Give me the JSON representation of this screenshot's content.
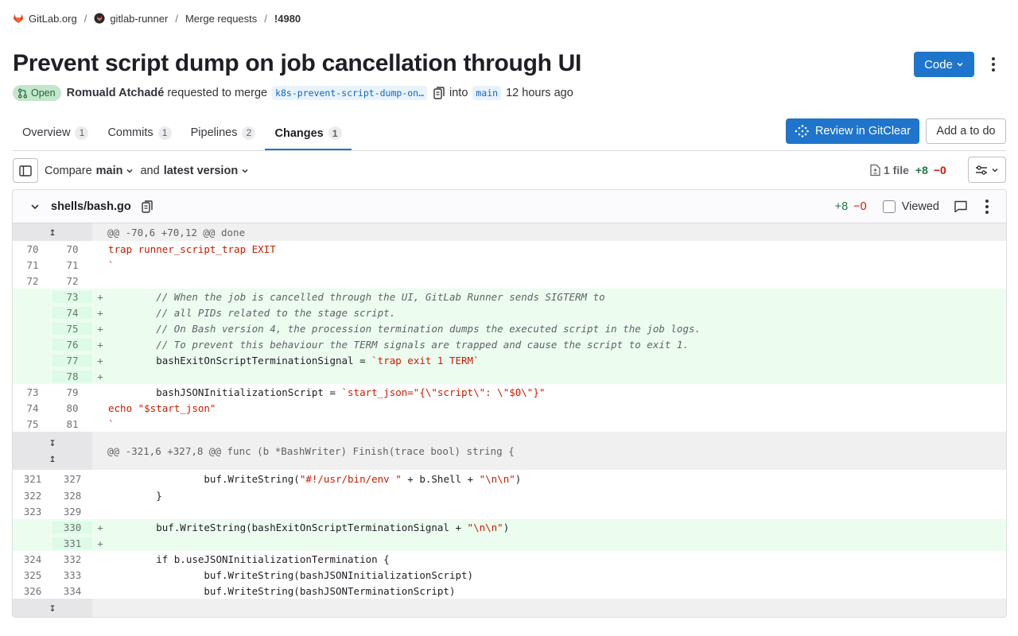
{
  "breadcrumb": [
    {
      "label": "GitLab.org",
      "icon": "gitlab-logo"
    },
    {
      "label": "gitlab-runner",
      "icon": "runner-avatar"
    },
    {
      "label": "Merge requests"
    },
    {
      "label": "!4980"
    }
  ],
  "title": "Prevent script dump on job cancellation through UI",
  "code_button": "Code",
  "meta": {
    "status": "Open",
    "author": "Romuald Atchadé",
    "requested_text": "requested to merge",
    "source_branch": "k8s-prevent-script-dump-on…",
    "into_text": "into",
    "target_branch": "main",
    "time": "12 hours ago"
  },
  "tabs": [
    {
      "label": "Overview",
      "count": "1"
    },
    {
      "label": "Commits",
      "count": "1"
    },
    {
      "label": "Pipelines",
      "count": "2"
    },
    {
      "label": "Changes",
      "count": "1"
    }
  ],
  "review_button": "Review in GitClear",
  "todo_button": "Add a to do",
  "compare": {
    "label": "Compare",
    "base": "main",
    "and_text": "and",
    "version": "latest version"
  },
  "stats": {
    "files": "1 file",
    "additions": "+8",
    "deletions": "−0"
  },
  "file": {
    "name": "shells/bash.go",
    "additions": "+8",
    "deletions": "−0",
    "viewed_label": "Viewed"
  },
  "hunks": {
    "h1": "@@ -70,6 +70,12 @@ done",
    "h2": "@@ -321,6 +327,8 @@ func (b *BashWriter) Finish(trace bool) string {"
  },
  "lines": {
    "l1": {
      "old": "70",
      "new": "70",
      "text": "trap runner_script_trap EXIT"
    },
    "l2": {
      "old": "71",
      "new": "71",
      "text": "`"
    },
    "l3": {
      "old": "72",
      "new": "72",
      "text": ""
    },
    "l4": {
      "new": "73",
      "text": "        // When the job is cancelled through the UI, GitLab Runner sends SIGTERM to"
    },
    "l5": {
      "new": "74",
      "text": "        // all PIDs related to the stage script."
    },
    "l6": {
      "new": "75",
      "text": "        // On Bash version 4, the procession termination dumps the executed script in the job logs."
    },
    "l7": {
      "new": "76",
      "text": "        // To prevent this behaviour the TERM signals are trapped and cause the script to exit 1."
    },
    "l8": {
      "new": "77",
      "code": "        bashExitOnScriptTerminationSignal = ",
      "str": "`trap exit 1 TERM`"
    },
    "l9": {
      "new": "78",
      "text": ""
    },
    "l10": {
      "old": "73",
      "new": "79",
      "code": "        bashJSONInitializationScript = ",
      "str": "`start_json=\"{\\\"script\\\": \\\"$0\\\"}\""
    },
    "l11": {
      "old": "74",
      "new": "80",
      "text": "echo \"$start_json\""
    },
    "l12": {
      "old": "75",
      "new": "81",
      "text": "`"
    },
    "l13": {
      "old": "321",
      "new": "327",
      "code": "                buf.WriteString(",
      "str": "\"#!/usr/bin/env \"",
      "code2": " + b.Shell + ",
      "str2": "\"\\n\\n\"",
      "code3": ")"
    },
    "l14": {
      "old": "322",
      "new": "328",
      "text": "        }"
    },
    "l15": {
      "old": "323",
      "new": "329",
      "text": ""
    },
    "l16": {
      "new": "330",
      "code": "        buf.WriteString(bashExitOnScriptTerminationSignal + ",
      "str": "\"\\n\\n\"",
      "code3": ")"
    },
    "l17": {
      "new": "331",
      "text": ""
    },
    "l18": {
      "old": "324",
      "new": "332",
      "text": "        if b.useJSONInitializationTermination {"
    },
    "l19": {
      "old": "325",
      "new": "333",
      "text": "                buf.WriteString(bashJSONInitializationScript)"
    },
    "l20": {
      "old": "326",
      "new": "334",
      "text": "                buf.WriteString(bashJSONTerminationScript)"
    }
  },
  "plus": "+",
  "colors": {
    "primary": "#1f75cb",
    "added_bg": "#ecfdf0",
    "added_gutter": "#ddfbe6",
    "open_badge": "#c3e6cd",
    "addition": "#217645",
    "deletion": "#c91c00"
  }
}
